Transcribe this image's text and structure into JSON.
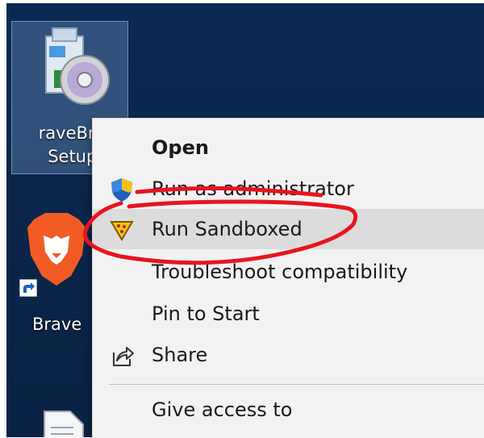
{
  "desktop": {
    "icons": [
      {
        "label": "BraveBrowserSetup_...",
        "lines": [
          "raveBrov",
          "Setup_"
        ]
      },
      {
        "label": "Brave"
      },
      {
        "label": ""
      }
    ]
  },
  "context_menu": {
    "items": [
      {
        "label": "Open",
        "bold": true
      },
      {
        "label": "Run as administrator",
        "icon": "uac-shield-icon"
      },
      {
        "label": "Run Sandboxed",
        "icon": "sandboxie-icon",
        "highlighted": true
      },
      {
        "label": "Troubleshoot compatibility"
      },
      {
        "label": "Pin to Start"
      },
      {
        "label": "Share",
        "icon": "share-icon"
      },
      {
        "label": "Give access to"
      }
    ]
  },
  "annotation": {
    "color": "#e8141e",
    "description_shapes": [
      "strike-line",
      "ellipse"
    ]
  },
  "colors": {
    "desktop": "#0a2549",
    "menu": "#f2f2f2",
    "highlight": "#dcdcdc"
  }
}
